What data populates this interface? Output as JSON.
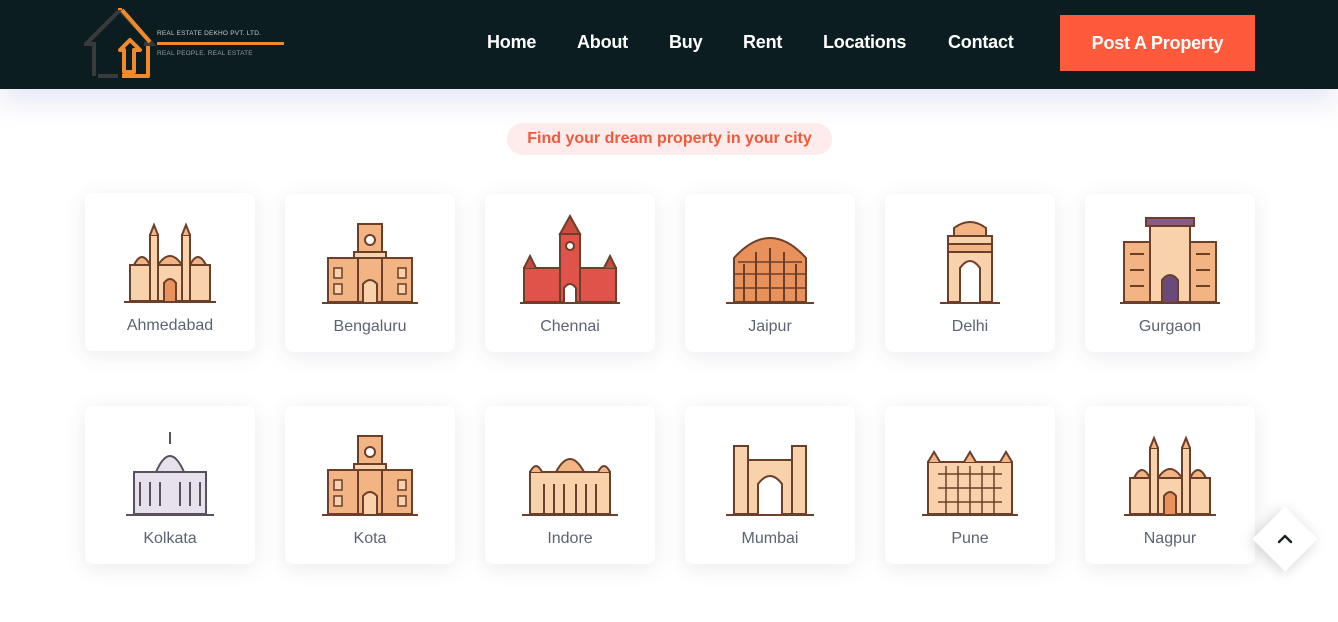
{
  "header": {
    "logo": {
      "company": "REAL ESTATE DEKHO PVT. LTD.",
      "tagline": "REAL PEOPLE.     REAL ESTATE"
    },
    "nav": [
      {
        "label": "Home",
        "name": "nav-home"
      },
      {
        "label": "About",
        "name": "nav-about"
      },
      {
        "label": "Buy",
        "name": "nav-buy"
      },
      {
        "label": "Rent",
        "name": "nav-rent"
      },
      {
        "label": "Locations",
        "name": "nav-locations"
      },
      {
        "label": "Contact",
        "name": "nav-contact"
      }
    ],
    "cta_label": "Post A Property"
  },
  "section": {
    "tag": "Find your dream property in your city"
  },
  "cities": [
    {
      "name": "Ahmedabad",
      "icon": "ahmedabad-monument-icon"
    },
    {
      "name": "Bengaluru",
      "icon": "bengaluru-monument-icon"
    },
    {
      "name": "Chennai",
      "icon": "chennai-monument-icon"
    },
    {
      "name": "Jaipur",
      "icon": "jaipur-monument-icon"
    },
    {
      "name": "Delhi",
      "icon": "delhi-monument-icon"
    },
    {
      "name": "Gurgaon",
      "icon": "gurgaon-monument-icon"
    },
    {
      "name": "Kolkata",
      "icon": "kolkata-monument-icon"
    },
    {
      "name": "Kota",
      "icon": "kota-monument-icon"
    },
    {
      "name": "Indore",
      "icon": "indore-monument-icon"
    },
    {
      "name": "Mumbai",
      "icon": "mumbai-monument-icon"
    },
    {
      "name": "Pune",
      "icon": "pune-monument-icon"
    },
    {
      "name": "Nagpur",
      "icon": "nagpur-monument-icon"
    }
  ],
  "scroll_top_icon": "chevron-up-icon",
  "colors": {
    "header_bg": "#0b1d21",
    "accent": "#ff5a3c",
    "logo_orange": "#f08a2c",
    "tag_bg": "#fdeceb",
    "city_text": "#5b6470"
  }
}
